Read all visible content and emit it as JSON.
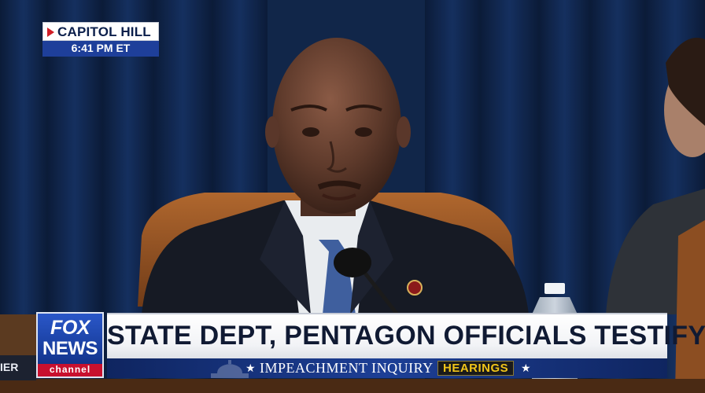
{
  "location_bug": {
    "location": "CAPITOL HILL",
    "time": "6:41 PM ET"
  },
  "logo": {
    "line1": "FOX",
    "line2": "NEWS",
    "line3": "channel"
  },
  "lower_third": {
    "headline": "STATE DEPT, PENTAGON OFFICIALS TESTIFY",
    "subheading": "IMPEACHMENT INQUIRY",
    "tag": "HEARINGS"
  },
  "nameplate": {
    "text": "IER"
  }
}
